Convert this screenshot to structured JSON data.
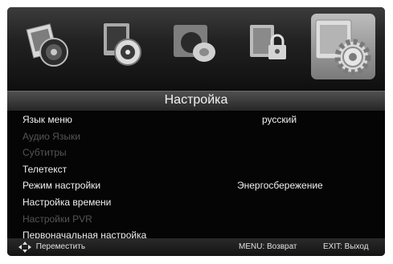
{
  "menu_title": "Настройка",
  "icons": [
    {
      "name": "photo-media-icon",
      "selected": false
    },
    {
      "name": "video-media-icon",
      "selected": false
    },
    {
      "name": "sound-icon",
      "selected": false
    },
    {
      "name": "lock-icon",
      "selected": false
    },
    {
      "name": "settings-gear-icon",
      "selected": true
    }
  ],
  "items": [
    {
      "label": "Язык меню",
      "value": "русский",
      "enabled": true
    },
    {
      "label": "Аудио Языки",
      "value": "",
      "enabled": false
    },
    {
      "label": "Субтитры",
      "value": "",
      "enabled": false
    },
    {
      "label": "Телетекст",
      "value": "",
      "enabled": true
    },
    {
      "label": "Режим настройки",
      "value": "Энергосбережение",
      "enabled": true
    },
    {
      "label": "Настройка времени",
      "value": "",
      "enabled": true
    },
    {
      "label": "Настройки PVR",
      "value": "",
      "enabled": false
    },
    {
      "label": "Первоначальная настройка",
      "value": "",
      "enabled": true
    }
  ],
  "footer": {
    "move_label": "Переместить",
    "menu_hint": "MENU: Возврат",
    "exit_hint": "EXIT: Выход"
  },
  "colors": {
    "background": "#050505",
    "text_enabled": "#f0f0f0",
    "text_disabled": "#555555",
    "selected_tile": "#a8a8a8"
  }
}
